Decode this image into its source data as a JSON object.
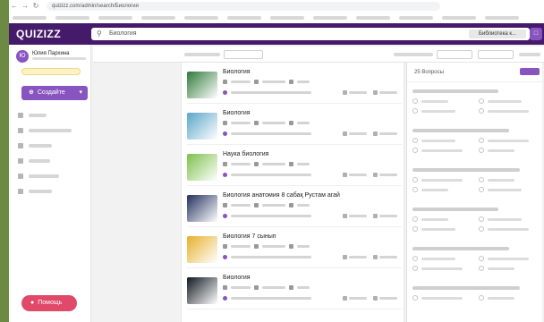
{
  "colors": {
    "brand": "#461a6b",
    "accent": "#8854c0",
    "help": "#e0496a",
    "background": "#f2f2f2"
  },
  "browser": {
    "url": "quizizz.com/admin/search/Биология"
  },
  "header": {
    "logo": "QUIZIZZ",
    "search_value": "Биология",
    "library_label": "Библиотека к...",
    "search_icon": "magnifier-icon",
    "gift_icon": "gift-icon"
  },
  "sidebar": {
    "avatar_letter": "Ю",
    "user_name": "Юлия Пархина",
    "create_label": "Создайте",
    "help_label": "Помощь",
    "items": [
      {
        "icon": "search-icon"
      },
      {
        "icon": "library-icon"
      },
      {
        "icon": "reports-icon"
      },
      {
        "icon": "classes-icon"
      },
      {
        "icon": "settings-icon"
      },
      {
        "icon": "chevron-down-icon"
      }
    ]
  },
  "results": [
    {
      "title": "Биология",
      "thumb": "#2f7a3a"
    },
    {
      "title": "Биология",
      "thumb": "#5aa5c7"
    },
    {
      "title": "Наука биология",
      "thumb": "#7dc04a"
    },
    {
      "title": "Биология анатомия 8 сабақ Рустам агай",
      "thumb": "#23305e"
    },
    {
      "title": "Биология 7 сынып",
      "thumb": "#e6b02c"
    },
    {
      "title": "Биология",
      "thumb": "#101820"
    }
  ],
  "preview": {
    "count_label": "25 Вопросы",
    "questions": [
      {
        "options": 4
      },
      {
        "options": 4
      },
      {
        "options": 4
      },
      {
        "options": 4
      },
      {
        "options": 4
      },
      {
        "options": 2
      }
    ]
  }
}
